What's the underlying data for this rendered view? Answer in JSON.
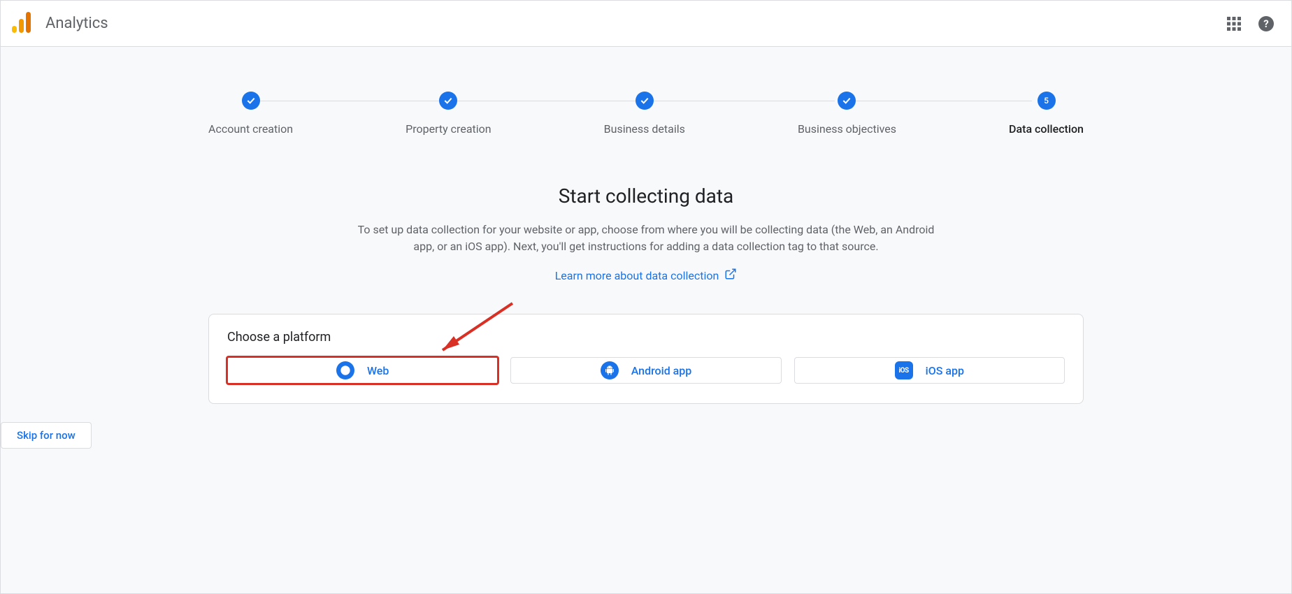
{
  "header": {
    "product_name": "Analytics"
  },
  "stepper": {
    "steps": [
      {
        "label": "Account creation",
        "done": true
      },
      {
        "label": "Property creation",
        "done": true
      },
      {
        "label": "Business details",
        "done": true
      },
      {
        "label": "Business objectives",
        "done": true
      },
      {
        "label": "Data collection",
        "done": false,
        "number": "5",
        "active": true
      }
    ]
  },
  "main": {
    "title": "Start collecting data",
    "description": "To set up data collection for your website or app, choose from where you will be collecting data (the Web, an Android app, or an iOS app). Next, you'll get instructions for adding a data collection tag to that source.",
    "learn_more": "Learn more about data collection"
  },
  "platform": {
    "card_title": "Choose a platform",
    "options": {
      "web": "Web",
      "android": "Android app",
      "ios": "iOS app",
      "ios_badge_text": "iOS"
    }
  },
  "actions": {
    "skip": "Skip for now"
  }
}
